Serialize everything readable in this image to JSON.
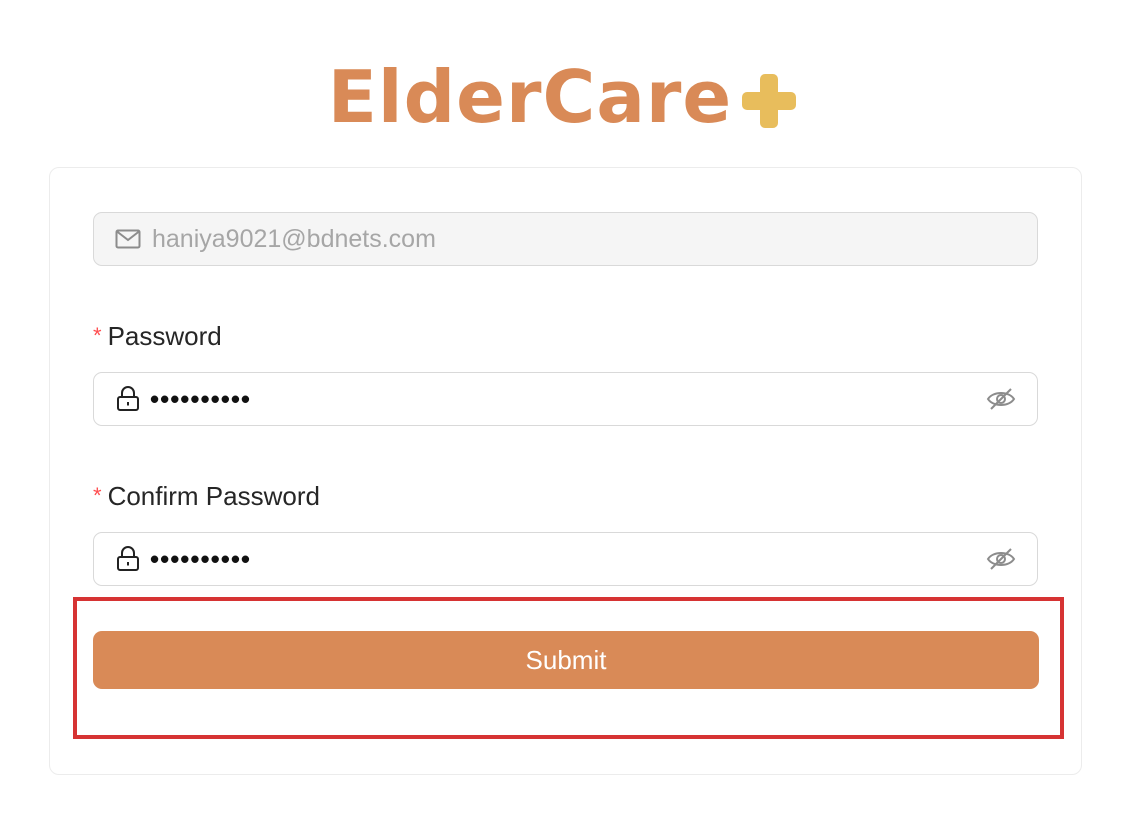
{
  "brand": {
    "name": "ElderCare",
    "logo_color": "#d98a57",
    "plus_color": "#e8bd5c"
  },
  "form": {
    "email": {
      "value": "haniya9021@bdnets.com",
      "icon": "mail-icon",
      "disabled": true
    },
    "password": {
      "label": "Password",
      "required_mark": "*",
      "masked_value": "••••••••••",
      "prefix_icon": "lock-icon",
      "suffix_icon": "eye-invisible-icon"
    },
    "confirm_password": {
      "label": "Confirm Password",
      "required_mark": "*",
      "masked_value": "••••••••••",
      "prefix_icon": "lock-icon",
      "suffix_icon": "eye-invisible-icon"
    },
    "submit_label": "Submit"
  },
  "colors": {
    "accent": "#d98a57",
    "required": "#ff4d4f",
    "highlight": "#d63333"
  }
}
